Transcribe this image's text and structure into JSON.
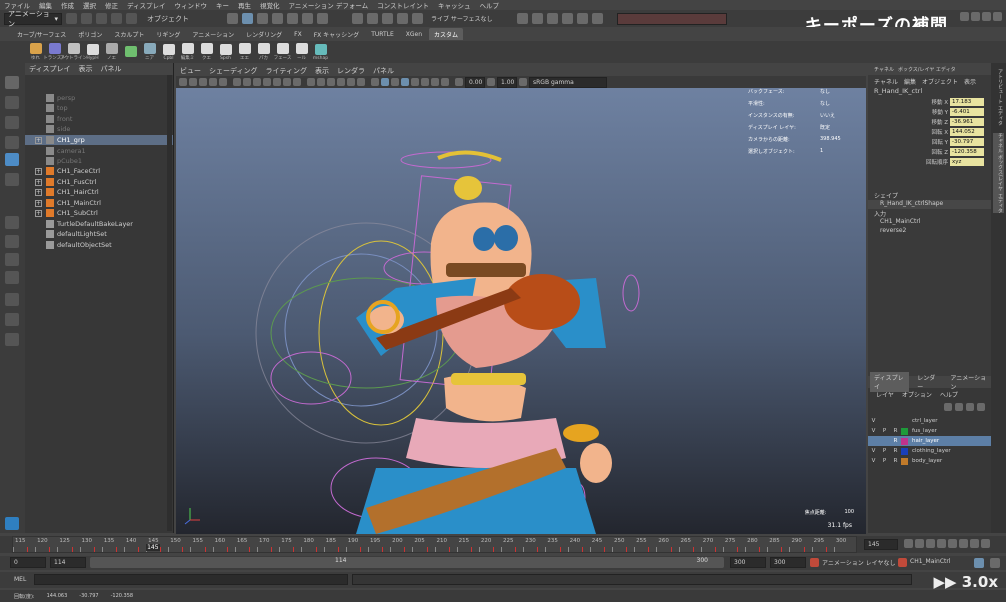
{
  "menubar": [
    "ファイル",
    "編集",
    "作成",
    "選択",
    "修正",
    "ディスプレイ",
    "ウィンドウ",
    "キー",
    "再生",
    "視覚化",
    "アニメーション デフォーム",
    "コンストレイント",
    "キャッシュ",
    "ヘルプ"
  ],
  "statusline": {
    "mode": "アニメーション",
    "object_mode": "オブジェクト",
    "snap_label": "ライブ サーフェスなし"
  },
  "watermark": "キーポーズの補間",
  "shelf_tabs": [
    "カーブ/サーフェス",
    "ポリゴン",
    "スカルプト",
    "リギング",
    "アニメーション",
    "レンダリング",
    "FX",
    "FX キャッシング",
    "TURTLE",
    "XGen",
    "カスタム"
  ],
  "shelf_active": "カスタム",
  "shelf_items": [
    "ゆれ",
    "トランスト",
    "アウトライン",
    "HypH",
    "ノエ",
    "",
    "ニア",
    "Cpbl",
    "編集ミ",
    "クエ",
    "Spsh",
    "エエ",
    "パカ",
    "フェース",
    "ール",
    "mshap"
  ],
  "outliner": {
    "menu": [
      "ディスプレイ",
      "表示",
      "パネル"
    ],
    "items": [
      {
        "label": "persp",
        "dim": true
      },
      {
        "label": "top",
        "dim": true
      },
      {
        "label": "front",
        "dim": true
      },
      {
        "label": "side",
        "dim": true
      },
      {
        "label": "CH1_grp",
        "hl": true
      },
      {
        "label": "camera1",
        "dim": true
      },
      {
        "label": "pCube1",
        "dim": true
      },
      {
        "label": "CH1_FaceCtrl"
      },
      {
        "label": "CH1_FusCtrl"
      },
      {
        "label": "CH1_HairCtrl"
      },
      {
        "label": "CH1_MainCtrl"
      },
      {
        "label": "CH1_SubCtrl"
      },
      {
        "label": "TurtleDefaultBakeLayer"
      },
      {
        "label": "defaultLightSet"
      },
      {
        "label": "defaultObjectSet"
      }
    ]
  },
  "viewport": {
    "menu": [
      "ビュー",
      "シェーディング",
      "ライティング",
      "表示",
      "レンダラ",
      "パネル"
    ],
    "exposure": "0.00",
    "gamma": "1.00",
    "colorspace": "sRGB gamma",
    "hud": [
      {
        "k": "バックフェース:",
        "v": "なし"
      },
      {
        "k": "平滑性:",
        "v": "なし"
      },
      {
        "k": "インスタンスの有無:",
        "v": "いいえ"
      },
      {
        "k": "ディスプレイ レイヤ:",
        "v": "既定"
      },
      {
        "k": "カメラからの距離:",
        "v": "398.945"
      },
      {
        "k": "選択しオブジェクト:",
        "v": "1"
      }
    ],
    "focal_label": "焦点距離:",
    "focal": "100",
    "fps": "31.1 fps"
  },
  "channel": {
    "tabs": [
      "チャネル",
      "ボックス/レイヤ エディタ"
    ],
    "menu": [
      "チャネル",
      "編集",
      "オブジェクト",
      "表示"
    ],
    "object": "R_Hand_IK_ctrl",
    "attrs": [
      {
        "n": "移動 X",
        "v": "17.183"
      },
      {
        "n": "移動 Y",
        "v": "-6.401"
      },
      {
        "n": "移動 Z",
        "v": "-36.961"
      },
      {
        "n": "回転 X",
        "v": "144.052"
      },
      {
        "n": "回転 Y",
        "v": "-30.797"
      },
      {
        "n": "回転 Z",
        "v": "-120.358"
      },
      {
        "n": "回転順序",
        "v": "xyz"
      }
    ],
    "shape_label": "シェイプ",
    "shape": "R_Hand_IK_ctrlShape",
    "input_label": "入力",
    "inputs": [
      "CH1_MainCtrl",
      "reverse2"
    ]
  },
  "side_tabs": [
    "アトリビュート エディタ",
    "チャネル ボックス/レイヤ エディタ"
  ],
  "layers": {
    "tabs": [
      "ディスプレイ",
      "レンダー",
      "アニメーション"
    ],
    "menu": [
      "レイヤ",
      "オプション",
      "ヘルプ"
    ],
    "rows": [
      {
        "v": "V",
        "p": "",
        "r": "",
        "label": "ctrl_layer",
        "color": "",
        "on": false
      },
      {
        "v": "V",
        "p": "P",
        "r": "R",
        "label": "fus_layer",
        "color": "#1e9a3a",
        "on": false
      },
      {
        "v": "",
        "p": "",
        "r": "R",
        "label": "hair_layer",
        "color": "#c0338c",
        "on": true
      },
      {
        "v": "V",
        "p": "P",
        "r": "R",
        "label": "clothing_layer",
        "color": "#1a3fb8",
        "on": false
      },
      {
        "v": "V",
        "p": "P",
        "r": "R",
        "label": "body_layer",
        "color": "#c07a2a",
        "on": false
      }
    ]
  },
  "timeline": {
    "ticks": [
      "115",
      "120",
      "125",
      "130",
      "135",
      "140",
      "145",
      "150",
      "155",
      "160",
      "165",
      "170",
      "175",
      "180",
      "185",
      "190",
      "195",
      "200",
      "205",
      "210",
      "215",
      "220",
      "225",
      "230",
      "235",
      "240",
      "245",
      "250",
      "255",
      "260",
      "265",
      "270",
      "275",
      "280",
      "285",
      "290",
      "295",
      "300"
    ],
    "current": "145",
    "current_box": "145"
  },
  "range": {
    "start": "0",
    "inner_start": "114",
    "range_start": "114",
    "range_end": "300",
    "inner_end": "300",
    "end": "300",
    "anim_layer": "アニメーション レイヤなし",
    "char_set": "CH1_MainCtrl"
  },
  "mel": {
    "label": "MEL"
  },
  "help": {
    "label": "回転(度):",
    "x": "144.063",
    "y": "-30.797",
    "z": "-120.358"
  },
  "speed": "▶▶ 3.0x"
}
